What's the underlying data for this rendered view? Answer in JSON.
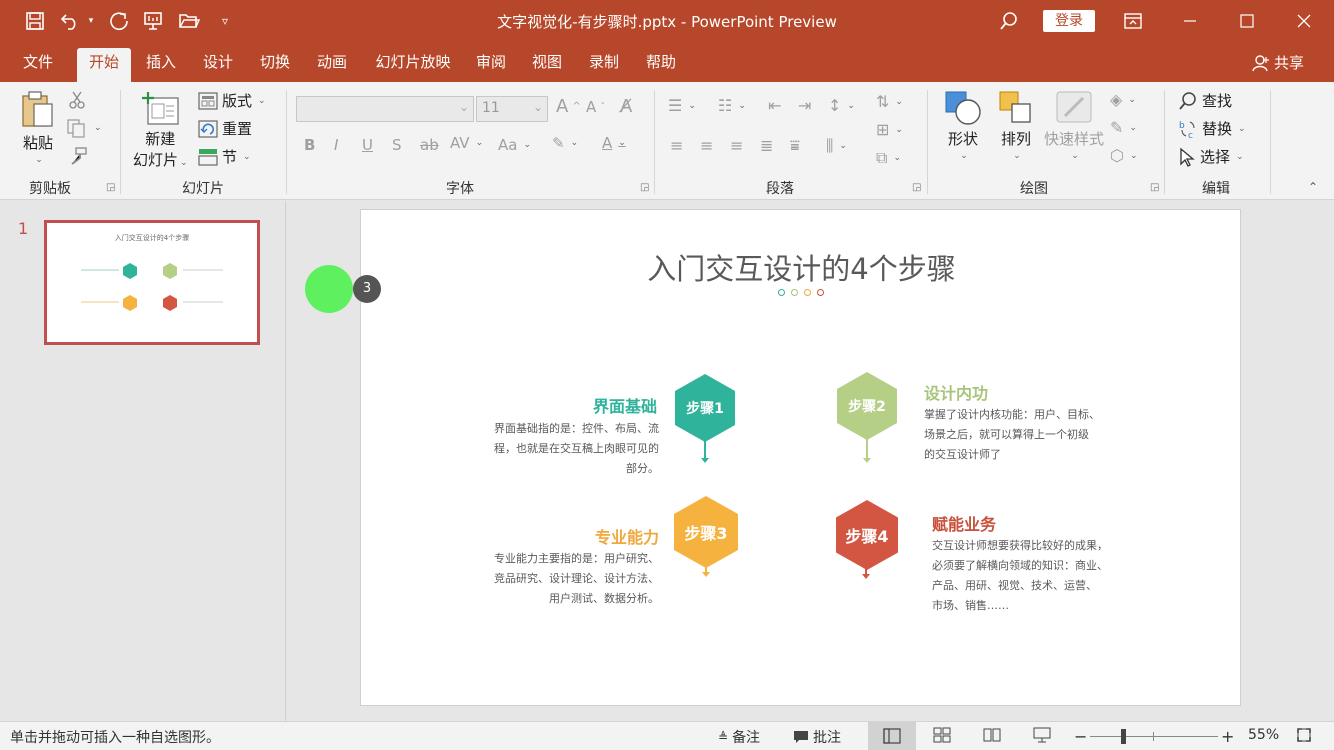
{
  "window": {
    "title": "文字视觉化-有步骤时.pptx  -  PowerPoint Preview",
    "login": "登录",
    "qat_icons": [
      "save-icon",
      "undo-icon",
      "redo-icon",
      "present-icon",
      "open-icon",
      "customize-icon"
    ],
    "caption_icons": [
      "search-icon",
      "ribbon-display-icon",
      "minimize-icon",
      "maximize-icon",
      "close-icon"
    ]
  },
  "tabs": [
    "文件",
    "开始",
    "插入",
    "设计",
    "切换",
    "动画",
    "幻灯片放映",
    "审阅",
    "视图",
    "录制",
    "帮助"
  ],
  "active_tab": "开始",
  "share": "共享",
  "ribbon": {
    "clipboard": {
      "label": "剪贴板",
      "paste": "粘贴"
    },
    "slides": {
      "label": "幻灯片",
      "new_slide_1": "新建",
      "new_slide_2": "幻灯片",
      "layout": "版式",
      "reset": "重置",
      "section": "节"
    },
    "font": {
      "label": "字体",
      "font_name": "",
      "font_size": "11"
    },
    "paragraph": {
      "label": "段落"
    },
    "drawing": {
      "label": "绘图",
      "shapes": "形状",
      "arrange": "排列",
      "quick_styles": "快速样式"
    },
    "editing": {
      "label": "编辑",
      "find": "查找",
      "replace": "替换",
      "select": "选择"
    }
  },
  "thumbnails": [
    {
      "number": "1",
      "title": "入门交互设计的4个步骤"
    }
  ],
  "slide": {
    "title": "入门交互设计的4个步骤",
    "dots": [
      "#2fb39b",
      "#a8c47a",
      "#f0a83c",
      "#c8503c"
    ],
    "steps": [
      {
        "badge": "步骤1",
        "heading": "界面基础",
        "color": "#2fb39b",
        "desc": [
          "界面基础指的是：控件、布局、流",
          "程，也就是在交互稿上肉眼可见的",
          "部分。"
        ]
      },
      {
        "badge": "步骤2",
        "heading": "设计内功",
        "color": "#b5cf86",
        "heading_color": "#a8c47a",
        "desc": [
          "掌握了设计内核功能：用户、目标、",
          "场景之后，就可以算得上一个初级",
          "的交互设计师了"
        ]
      },
      {
        "badge": "步骤3",
        "heading": "专业能力",
        "color": "#f5b23e",
        "heading_color": "#f0a83c",
        "desc": [
          "专业能力主要指的是：用户研究、",
          "竞品研究、设计理论、设计方法、",
          "用户测试、数据分析。"
        ]
      },
      {
        "badge": "步骤4",
        "heading": "赋能业务",
        "color": "#d35642",
        "heading_color": "#c8503c",
        "desc": [
          "交互设计师想要获得比较好的成果，",
          "必须要了解横向领域的知识：商业、",
          "产品、用研、视觉、技术、运营、",
          "市场、销售……"
        ]
      }
    ]
  },
  "cursor": {
    "badge": "3"
  },
  "status": {
    "hint": "单击并拖动可插入一种自选图形。",
    "notes": "备注",
    "comments": "批注",
    "zoom_minus": "−",
    "zoom_plus": "+",
    "zoom_percent": "55%",
    "zoom_level": 0.55
  }
}
